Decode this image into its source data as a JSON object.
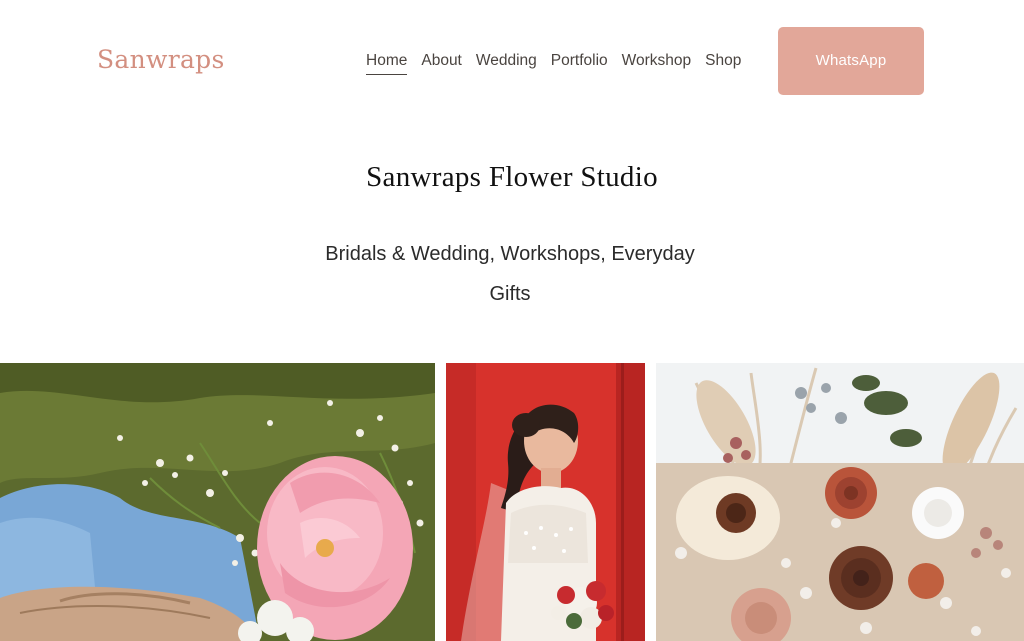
{
  "site": {
    "logo_text": "Sanwraps"
  },
  "nav": {
    "items": [
      {
        "label": "Home",
        "active": true
      },
      {
        "label": "About"
      },
      {
        "label": "Wedding"
      },
      {
        "label": "Portfolio"
      },
      {
        "label": "Workshop"
      },
      {
        "label": "Shop"
      }
    ],
    "cta_label": "WhatsApp"
  },
  "hero": {
    "title": "Sanwraps Flower Studio",
    "subtitle_line1": "Bridals & Wedding, Workshops, Everyday",
    "subtitle_line2": "Gifts"
  },
  "colors": {
    "brand": "#d38f80",
    "cta_bg": "#e2a799",
    "nav_text": "#4a4440"
  },
  "gallery": {
    "images": [
      {
        "icon": "flowers-on-moss-photo"
      },
      {
        "icon": "bride-with-bouquet-photo"
      },
      {
        "icon": "dried-flower-bouquet-photo"
      }
    ]
  }
}
